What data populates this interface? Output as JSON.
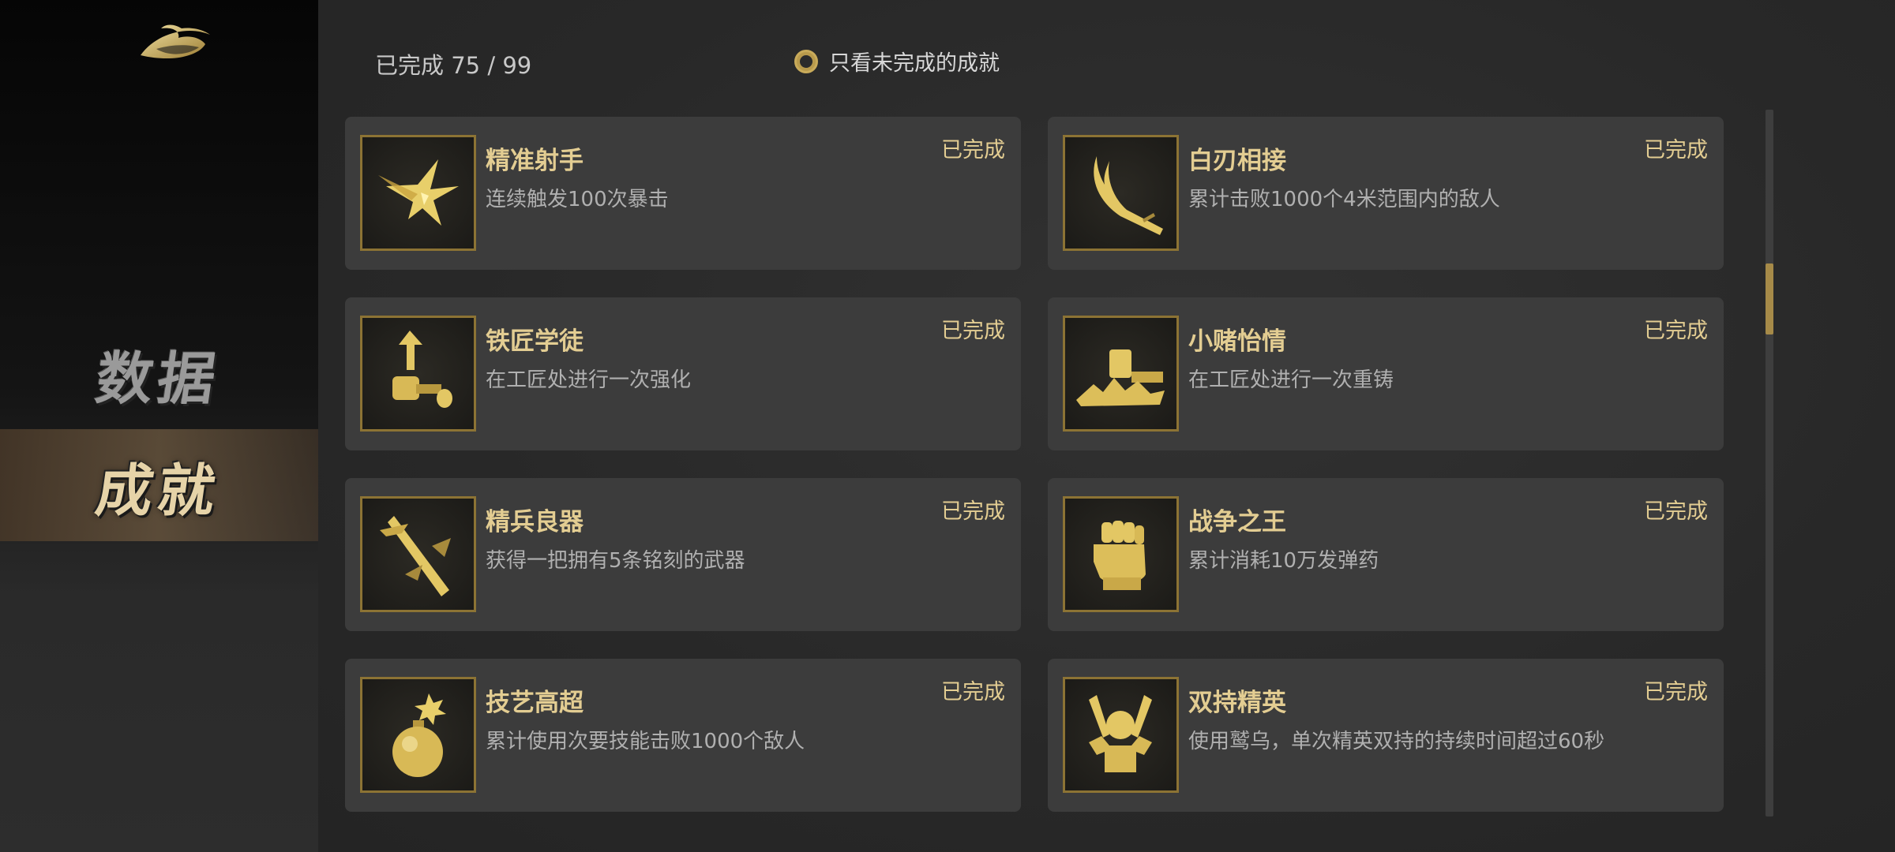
{
  "sidebar": {
    "logo_icon": "golden-swoosh-logo",
    "items": [
      {
        "label": "数据",
        "active": false
      },
      {
        "label": "成就",
        "active": true
      }
    ]
  },
  "header": {
    "progress_text": "已完成 75 / 99",
    "filter_label": "只看未完成的成就"
  },
  "colors": {
    "gold": "#e3cd92",
    "card_bg": "#3c3c3c",
    "scroll_thumb": "#a68a48"
  },
  "achievements": [
    {
      "title": "精准射手",
      "desc": "连续触发100次暴击",
      "status": "已完成",
      "icon": "critical-spark-icon"
    },
    {
      "title": "白刃相接",
      "desc": "累计击败1000个4米范围内的敌人",
      "status": "已完成",
      "icon": "blade-icon"
    },
    {
      "title": "铁匠学徒",
      "desc": "在工匠处进行一次强化",
      "status": "已完成",
      "icon": "hammer-upgrade-icon"
    },
    {
      "title": "小赌怡情",
      "desc": "在工匠处进行一次重铸",
      "status": "已完成",
      "icon": "anvil-icon"
    },
    {
      "title": "精兵良器",
      "desc": "获得一把拥有5条铭刻的武器",
      "status": "已完成",
      "icon": "engraved-sword-icon"
    },
    {
      "title": "战争之王",
      "desc": "累计消耗10万发弹药",
      "status": "已完成",
      "icon": "fist-icon"
    },
    {
      "title": "技艺高超",
      "desc": "累计使用次要技能击败1000个敌人",
      "status": "已完成",
      "icon": "bomb-icon"
    },
    {
      "title": "双持精英",
      "desc": "使用鹫乌，单次精英双持的持续时间超过60秒",
      "status": "已完成",
      "icon": "dual-wield-icon"
    }
  ]
}
